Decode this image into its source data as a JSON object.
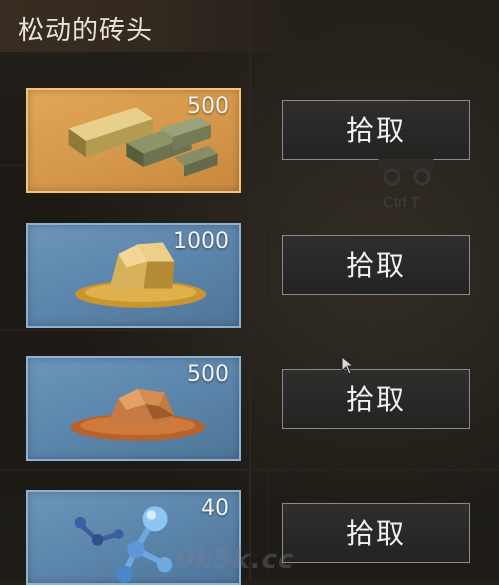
{
  "panel": {
    "title": "松动的砖头"
  },
  "items": [
    {
      "name": "gold-bars",
      "quantity": "500",
      "action": "拾取",
      "frame": "gold"
    },
    {
      "name": "gold-ore",
      "quantity": "1000",
      "action": "拾取",
      "frame": "blue"
    },
    {
      "name": "copper-ore",
      "quantity": "500",
      "action": "拾取",
      "frame": "blue"
    },
    {
      "name": "molecule-crystal",
      "quantity": "40",
      "action": "拾取",
      "frame": "blue"
    }
  ],
  "hint": {
    "shortcut": "Ctrl T",
    "icon": "cart-icon"
  },
  "watermark": {
    "text": "9k5k.cc"
  },
  "colors": {
    "gold_frame": "#d89a4c",
    "blue_frame": "#5f88ae",
    "button_bg": "#2a2927"
  }
}
